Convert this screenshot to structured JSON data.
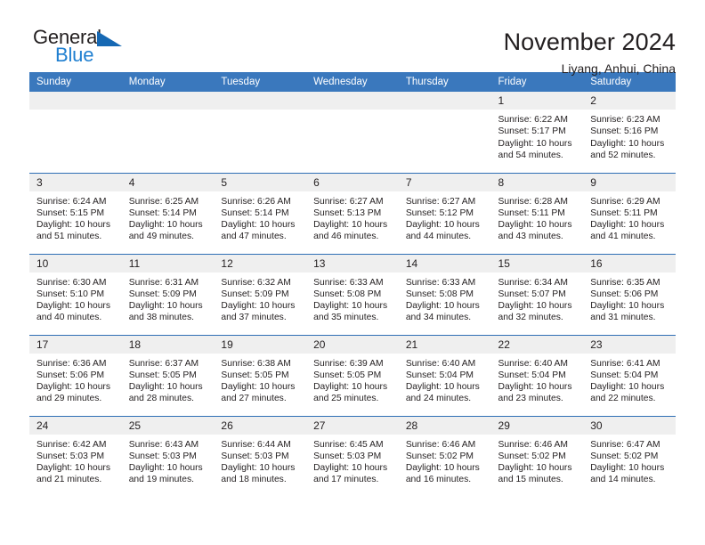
{
  "brand": {
    "name_primary": "General",
    "name_secondary": "Blue",
    "triangle_color": "#1668b3",
    "blue_color": "#1f7fd0"
  },
  "header": {
    "title": "November 2024",
    "subtitle": "Liyang, Anhui, China"
  },
  "theme": {
    "header_bar_color": "#3a78bd",
    "row_divider_color": "#2f6fb5",
    "daynum_band_color": "#efefef",
    "text_color": "#231f20"
  },
  "calendar": {
    "weekday_headers": [
      "Sunday",
      "Monday",
      "Tuesday",
      "Wednesday",
      "Thursday",
      "Friday",
      "Saturday"
    ],
    "weeks": [
      [
        {
          "day": "",
          "empty": true
        },
        {
          "day": "",
          "empty": true
        },
        {
          "day": "",
          "empty": true
        },
        {
          "day": "",
          "empty": true
        },
        {
          "day": "",
          "empty": true
        },
        {
          "day": "1",
          "sunrise": "Sunrise: 6:22 AM",
          "sunset": "Sunset: 5:17 PM",
          "daylight": "Daylight: 10 hours and 54 minutes."
        },
        {
          "day": "2",
          "sunrise": "Sunrise: 6:23 AM",
          "sunset": "Sunset: 5:16 PM",
          "daylight": "Daylight: 10 hours and 52 minutes."
        }
      ],
      [
        {
          "day": "3",
          "sunrise": "Sunrise: 6:24 AM",
          "sunset": "Sunset: 5:15 PM",
          "daylight": "Daylight: 10 hours and 51 minutes."
        },
        {
          "day": "4",
          "sunrise": "Sunrise: 6:25 AM",
          "sunset": "Sunset: 5:14 PM",
          "daylight": "Daylight: 10 hours and 49 minutes."
        },
        {
          "day": "5",
          "sunrise": "Sunrise: 6:26 AM",
          "sunset": "Sunset: 5:14 PM",
          "daylight": "Daylight: 10 hours and 47 minutes."
        },
        {
          "day": "6",
          "sunrise": "Sunrise: 6:27 AM",
          "sunset": "Sunset: 5:13 PM",
          "daylight": "Daylight: 10 hours and 46 minutes."
        },
        {
          "day": "7",
          "sunrise": "Sunrise: 6:27 AM",
          "sunset": "Sunset: 5:12 PM",
          "daylight": "Daylight: 10 hours and 44 minutes."
        },
        {
          "day": "8",
          "sunrise": "Sunrise: 6:28 AM",
          "sunset": "Sunset: 5:11 PM",
          "daylight": "Daylight: 10 hours and 43 minutes."
        },
        {
          "day": "9",
          "sunrise": "Sunrise: 6:29 AM",
          "sunset": "Sunset: 5:11 PM",
          "daylight": "Daylight: 10 hours and 41 minutes."
        }
      ],
      [
        {
          "day": "10",
          "sunrise": "Sunrise: 6:30 AM",
          "sunset": "Sunset: 5:10 PM",
          "daylight": "Daylight: 10 hours and 40 minutes."
        },
        {
          "day": "11",
          "sunrise": "Sunrise: 6:31 AM",
          "sunset": "Sunset: 5:09 PM",
          "daylight": "Daylight: 10 hours and 38 minutes."
        },
        {
          "day": "12",
          "sunrise": "Sunrise: 6:32 AM",
          "sunset": "Sunset: 5:09 PM",
          "daylight": "Daylight: 10 hours and 37 minutes."
        },
        {
          "day": "13",
          "sunrise": "Sunrise: 6:33 AM",
          "sunset": "Sunset: 5:08 PM",
          "daylight": "Daylight: 10 hours and 35 minutes."
        },
        {
          "day": "14",
          "sunrise": "Sunrise: 6:33 AM",
          "sunset": "Sunset: 5:08 PM",
          "daylight": "Daylight: 10 hours and 34 minutes."
        },
        {
          "day": "15",
          "sunrise": "Sunrise: 6:34 AM",
          "sunset": "Sunset: 5:07 PM",
          "daylight": "Daylight: 10 hours and 32 minutes."
        },
        {
          "day": "16",
          "sunrise": "Sunrise: 6:35 AM",
          "sunset": "Sunset: 5:06 PM",
          "daylight": "Daylight: 10 hours and 31 minutes."
        }
      ],
      [
        {
          "day": "17",
          "sunrise": "Sunrise: 6:36 AM",
          "sunset": "Sunset: 5:06 PM",
          "daylight": "Daylight: 10 hours and 29 minutes."
        },
        {
          "day": "18",
          "sunrise": "Sunrise: 6:37 AM",
          "sunset": "Sunset: 5:05 PM",
          "daylight": "Daylight: 10 hours and 28 minutes."
        },
        {
          "day": "19",
          "sunrise": "Sunrise: 6:38 AM",
          "sunset": "Sunset: 5:05 PM",
          "daylight": "Daylight: 10 hours and 27 minutes."
        },
        {
          "day": "20",
          "sunrise": "Sunrise: 6:39 AM",
          "sunset": "Sunset: 5:05 PM",
          "daylight": "Daylight: 10 hours and 25 minutes."
        },
        {
          "day": "21",
          "sunrise": "Sunrise: 6:40 AM",
          "sunset": "Sunset: 5:04 PM",
          "daylight": "Daylight: 10 hours and 24 minutes."
        },
        {
          "day": "22",
          "sunrise": "Sunrise: 6:40 AM",
          "sunset": "Sunset: 5:04 PM",
          "daylight": "Daylight: 10 hours and 23 minutes."
        },
        {
          "day": "23",
          "sunrise": "Sunrise: 6:41 AM",
          "sunset": "Sunset: 5:04 PM",
          "daylight": "Daylight: 10 hours and 22 minutes."
        }
      ],
      [
        {
          "day": "24",
          "sunrise": "Sunrise: 6:42 AM",
          "sunset": "Sunset: 5:03 PM",
          "daylight": "Daylight: 10 hours and 21 minutes."
        },
        {
          "day": "25",
          "sunrise": "Sunrise: 6:43 AM",
          "sunset": "Sunset: 5:03 PM",
          "daylight": "Daylight: 10 hours and 19 minutes."
        },
        {
          "day": "26",
          "sunrise": "Sunrise: 6:44 AM",
          "sunset": "Sunset: 5:03 PM",
          "daylight": "Daylight: 10 hours and 18 minutes."
        },
        {
          "day": "27",
          "sunrise": "Sunrise: 6:45 AM",
          "sunset": "Sunset: 5:03 PM",
          "daylight": "Daylight: 10 hours and 17 minutes."
        },
        {
          "day": "28",
          "sunrise": "Sunrise: 6:46 AM",
          "sunset": "Sunset: 5:02 PM",
          "daylight": "Daylight: 10 hours and 16 minutes."
        },
        {
          "day": "29",
          "sunrise": "Sunrise: 6:46 AM",
          "sunset": "Sunset: 5:02 PM",
          "daylight": "Daylight: 10 hours and 15 minutes."
        },
        {
          "day": "30",
          "sunrise": "Sunrise: 6:47 AM",
          "sunset": "Sunset: 5:02 PM",
          "daylight": "Daylight: 10 hours and 14 minutes."
        }
      ]
    ]
  }
}
